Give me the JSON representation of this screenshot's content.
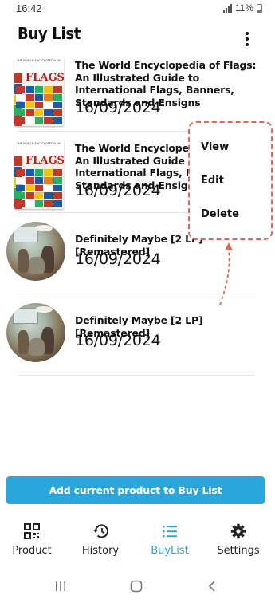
{
  "status_bar": {
    "time": "16:42",
    "battery": "11%"
  },
  "header": {
    "title": "Buy List"
  },
  "items": [
    {
      "name": "The World Encyclopedia of Flags: An Illustrated Guide to International Flags, Banners, Standards and Ensigns",
      "date": "16/09/2024",
      "cover": "flags-book"
    },
    {
      "name": "The World Encyclopedia of Flags: An Illustrated Guide to International Flags, Banners, Standards and Ensigns",
      "date": "16/09/2024",
      "cover": "flags-book"
    },
    {
      "name": "Definitely Maybe [2 LP][Remastered]",
      "date": "16/09/2024",
      "cover": "album"
    },
    {
      "name": "Definitely Maybe [2 LP][Remastered]",
      "date": "16/09/2024",
      "cover": "album"
    }
  ],
  "book_cover": {
    "series_text": "THE WORLD ENCYCLOPEDIA OF",
    "word": "FLAGS"
  },
  "context_menu": {
    "items": [
      "View",
      "Edit",
      "Delete"
    ]
  },
  "actions": {
    "add_button": "Add current product to Buy List"
  },
  "bottom_nav": {
    "tabs": [
      {
        "label": "Product",
        "icon": "qr-code-icon",
        "active": false
      },
      {
        "label": "History",
        "icon": "history-icon",
        "active": false
      },
      {
        "label": "BuyList",
        "icon": "list-icon",
        "active": true
      },
      {
        "label": "Settings",
        "icon": "gear-icon",
        "active": false
      }
    ]
  },
  "colors": {
    "accent": "#29a7dc",
    "annotation": "#e06a4b",
    "active_tab": "#2aa3db"
  }
}
